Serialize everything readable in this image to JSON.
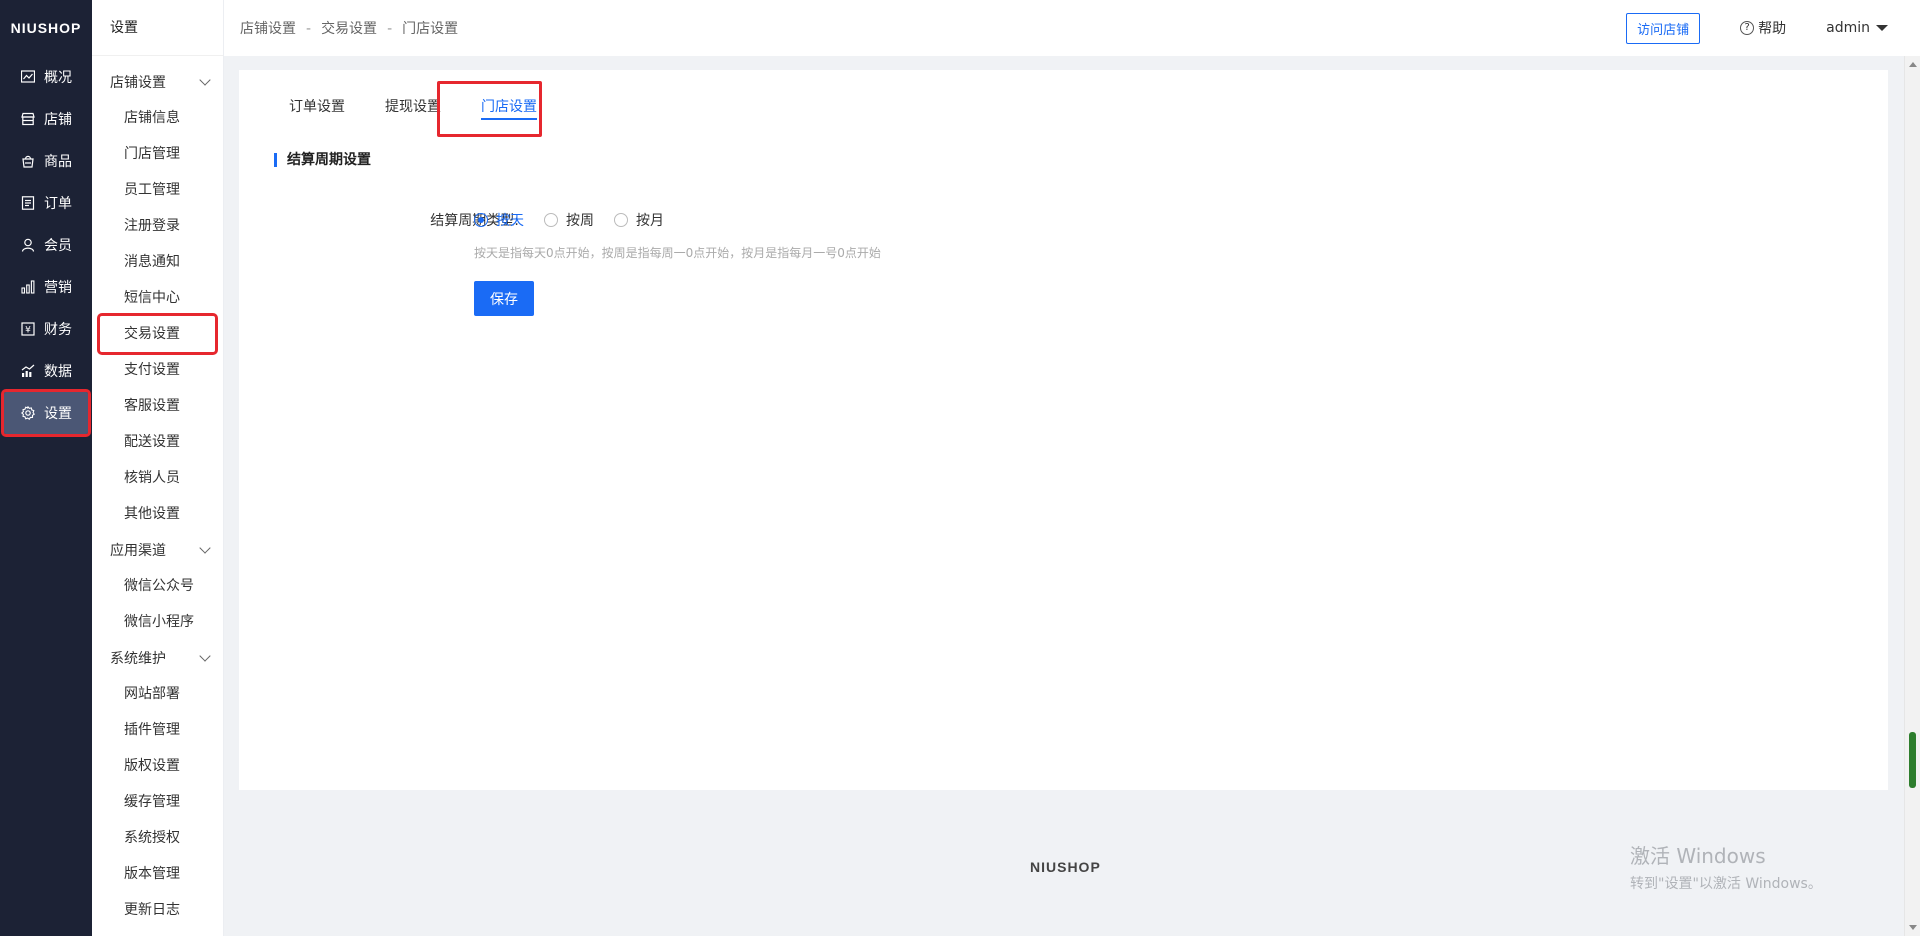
{
  "rail": {
    "logo": "NIUSHOP",
    "items": [
      {
        "label": "概况",
        "icon": "overview-icon"
      },
      {
        "label": "店铺",
        "icon": "store-icon"
      },
      {
        "label": "商品",
        "icon": "goods-icon"
      },
      {
        "label": "订单",
        "icon": "order-icon"
      },
      {
        "label": "会员",
        "icon": "member-icon"
      },
      {
        "label": "营销",
        "icon": "marketing-icon"
      },
      {
        "label": "财务",
        "icon": "finance-icon"
      },
      {
        "label": "数据",
        "icon": "data-icon"
      },
      {
        "label": "设置",
        "icon": "gear-icon",
        "active": true
      }
    ]
  },
  "submenu": {
    "title": "设置",
    "groups": [
      {
        "label": "店铺设置",
        "items": [
          "店铺信息",
          "门店管理",
          "员工管理",
          "注册登录",
          "消息通知",
          "短信中心",
          "交易设置",
          "支付设置",
          "客服设置",
          "配送设置",
          "核销人员",
          "其他设置"
        ]
      },
      {
        "label": "应用渠道",
        "items": [
          "微信公众号",
          "微信小程序"
        ]
      },
      {
        "label": "系统维护",
        "items": [
          "网站部署",
          "插件管理",
          "版权设置",
          "缓存管理",
          "系统授权",
          "版本管理",
          "更新日志"
        ]
      }
    ]
  },
  "topbar": {
    "breadcrumb": [
      "店铺设置",
      "交易设置",
      "门店设置"
    ],
    "separator": "-",
    "visit_store": "访问店铺",
    "help": "帮助",
    "user": "admin"
  },
  "tabs": [
    "订单设置",
    "提现设置",
    "门店设置"
  ],
  "section": {
    "title": "结算周期设置"
  },
  "form": {
    "label": "结算周期类型:",
    "options": [
      "按天",
      "按周",
      "按月"
    ],
    "selected": "按天",
    "hint": "按天是指每天0点开始，按周是指每周一0点开始，按月是指每月一号0点开始",
    "save": "保存"
  },
  "footer": {
    "logo": "NIUSHOP"
  },
  "watermark": {
    "line1": "激活 Windows",
    "line2": "转到\"设置\"以激活 Windows。"
  },
  "colors": {
    "accent": "#1a6bf5",
    "rail_bg": "#1c2235",
    "highlight": "#e6272e"
  }
}
